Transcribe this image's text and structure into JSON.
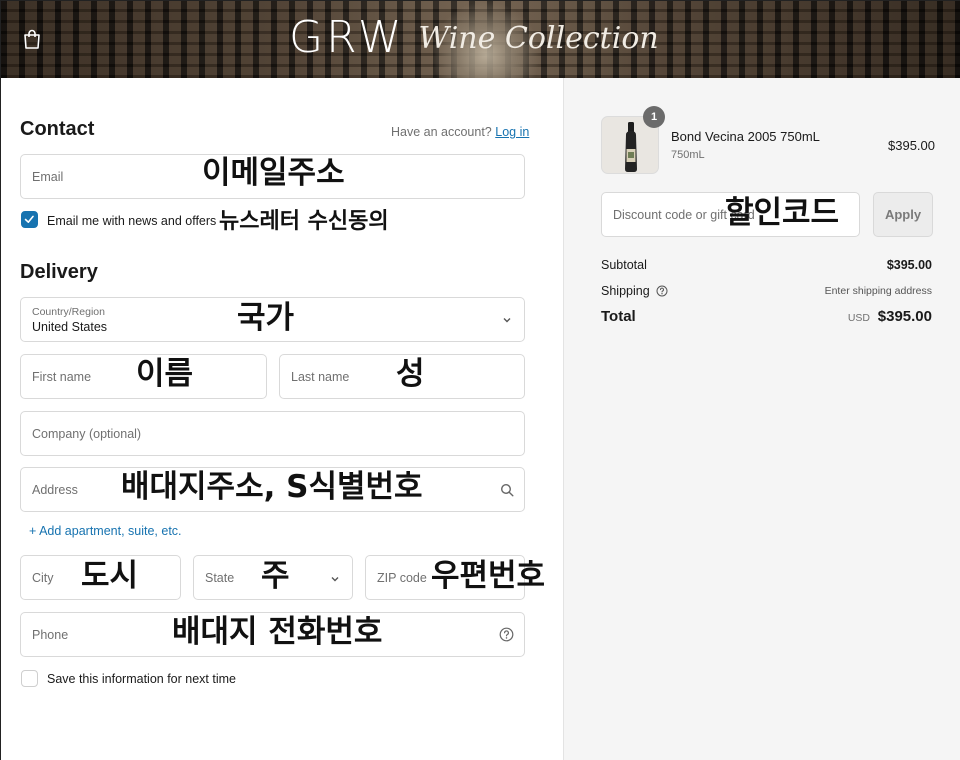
{
  "header": {
    "brand_main": "GRW",
    "brand_script": "Wine Collection"
  },
  "contact": {
    "title": "Contact",
    "have_account": "Have an account?",
    "login_link": "Log in",
    "email_placeholder": "Email",
    "email_overlay": "이메일주소",
    "newsletter_label": "Email me with news and offers",
    "newsletter_overlay": "뉴스레터 수신동의",
    "newsletter_checked": true
  },
  "delivery": {
    "title": "Delivery",
    "country_label": "Country/Region",
    "country_value": "United States",
    "country_overlay": "국가",
    "first_name_placeholder": "First name",
    "first_name_overlay": "이름",
    "last_name_placeholder": "Last name",
    "last_name_overlay": "성",
    "company_placeholder": "Company (optional)",
    "address_placeholder": "Address",
    "address_overlay": "배대지주소, S식별번호",
    "add_apartment": "+ Add apartment, suite, etc.",
    "city_placeholder": "City",
    "city_overlay": "도시",
    "state_placeholder": "State",
    "state_overlay": "주",
    "zip_placeholder": "ZIP code",
    "zip_overlay": "우편번호",
    "phone_placeholder": "Phone",
    "phone_overlay": "배대지 전화번호",
    "save_info_label": "Save this information for next time",
    "save_info_checked": false
  },
  "summary": {
    "item_quantity": "1",
    "item_name": "Bond Vecina 2005 750mL",
    "item_variant": "750mL",
    "item_price": "$395.00",
    "discount_placeholder": "Discount code or gift card",
    "discount_overlay": "할인코드",
    "apply_label": "Apply",
    "subtotal_label": "Subtotal",
    "subtotal_value": "$395.00",
    "shipping_label": "Shipping",
    "shipping_value": "Enter shipping address",
    "total_label": "Total",
    "total_currency": "USD",
    "total_value": "$395.00"
  },
  "colors": {
    "accent": "#1773b0",
    "summary_bg": "#f5f5f5",
    "border": "#d9d9d9"
  },
  "icons": [
    "shopping-bag-icon",
    "chevron-down-icon",
    "search-icon",
    "help-circle-icon",
    "checkmark-icon",
    "wine-bottle-icon"
  ]
}
